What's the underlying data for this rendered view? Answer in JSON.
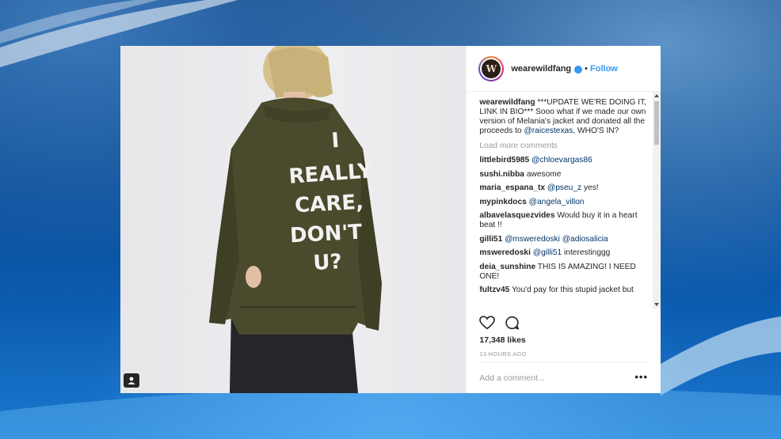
{
  "post": {
    "username": "wearewildfang",
    "avatar_letter": "W",
    "follow_label": "Follow",
    "separator": "•",
    "jacket_text": [
      "I",
      "REALLY",
      "CARE,",
      "DON'T",
      "U?"
    ],
    "caption": {
      "user": "wearewildfang",
      "text_before": "***UPDATE WE'RE DOING IT, LINK IN BIO*** Sooo what if we made our own version of Melania's jacket and donated all the proceeds to ",
      "mention": "@raicestexas",
      "text_after": ", WHO'S IN?"
    },
    "load_more": "Load more comments",
    "comments": [
      {
        "user": "littlebird5985",
        "mention": "@chloevargas86",
        "text": ""
      },
      {
        "user": "sushi.nibba",
        "mention": "",
        "text": "awesome"
      },
      {
        "user": "maria_espana_tx",
        "mention": "@pseu_z",
        "text": "yes!"
      },
      {
        "user": "mypinkdocs",
        "mention": "@angela_villon",
        "text": ""
      },
      {
        "user": "albavelasquezvides",
        "mention": "",
        "text": "Would buy it in a heart beat !!"
      },
      {
        "user": "gilli51",
        "mention": "@msweredoski @adiosalicia",
        "text": ""
      },
      {
        "user": "msweredoski",
        "mention": "@gilli51",
        "text": "interestinggg"
      },
      {
        "user": "deia_sunshine",
        "mention": "",
        "text": "THIS IS AMAZING! I NEED ONE!"
      },
      {
        "user": "fultzv45",
        "mention": "",
        "text": "You'd pay for this stupid jacket but"
      }
    ],
    "likes": "17,348 likes",
    "time_ago": "13 HOURS AGO",
    "add_comment_placeholder": "Add a comment...",
    "more_options": "•••",
    "icons": {
      "like": "heart-icon",
      "comment": "comment-icon",
      "tag": "user-tag-icon",
      "verified": "verified-badge-icon"
    },
    "colors": {
      "accent": "#3897f0",
      "mention": "#003569",
      "jacket": "#4a4a2c"
    }
  }
}
